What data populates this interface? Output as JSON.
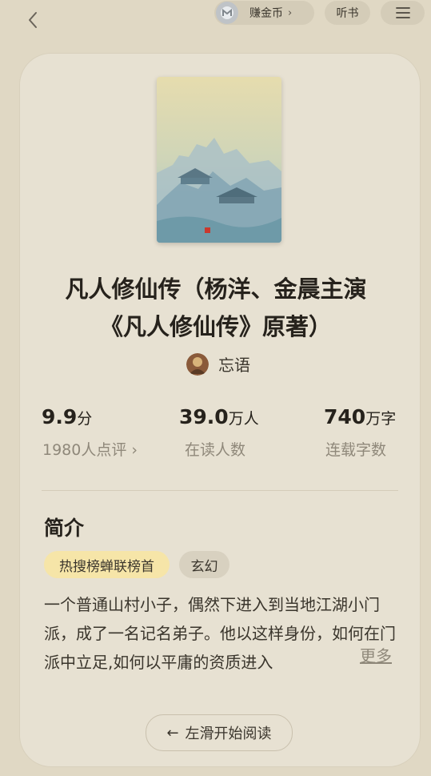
{
  "topbar": {
    "back_icon": "chevron-left-icon",
    "coin_label": "赚金币",
    "coin_chevron": "›",
    "listen_label": "听书",
    "menu_icon": "hamburger-menu-icon"
  },
  "book": {
    "cover_title": "凡人修仙传",
    "title": "凡人修仙传（杨洋、金晨主演《凡人修仙传》原著）",
    "author": "忘语"
  },
  "stats": {
    "rating": {
      "value": "9.9",
      "unit": "分",
      "sub": "1980人点评 ›"
    },
    "readers": {
      "value": "39.0",
      "unit": "万人",
      "sub": "在读人数"
    },
    "words": {
      "value": "740",
      "unit": "万字",
      "sub": "连载字数"
    }
  },
  "intro": {
    "heading": "简介",
    "tags": [
      "热搜榜蝉联榜首",
      "玄幻"
    ],
    "text": "一个普通山村小子，偶然下进入到当地江湖小门派，成了一名记名弟子。他以这样身份，如何在门派中立足,如何以平庸的资质进入",
    "more_label": "更多"
  },
  "cta": {
    "label": "左滑开始阅读",
    "arrow": "←"
  },
  "colors": {
    "background": "#e0d8c4",
    "card": "#e7e1d2",
    "hot_tag": "#f6e5a8",
    "muted_text": "#8f887a"
  }
}
